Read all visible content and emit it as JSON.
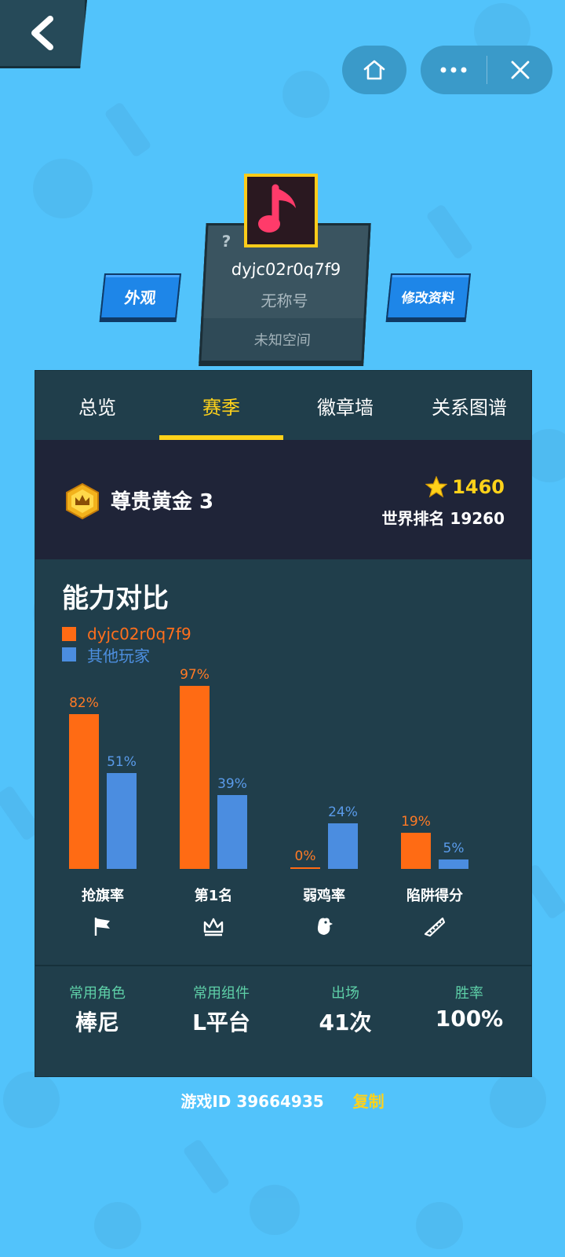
{
  "profile": {
    "username": "dyjc02r0q7f9",
    "title": "无称号",
    "space": "未知空间",
    "unknown_mark": "?",
    "appearance_button": "外观",
    "edit_button": "修改资料"
  },
  "tabs": [
    {
      "label": "总览"
    },
    {
      "label": "赛季"
    },
    {
      "label": "徽章墙"
    },
    {
      "label": "关系图谱"
    }
  ],
  "rank": {
    "name": "尊贵黄金 3",
    "stars": "1460",
    "world_rank": "世界排名 19260"
  },
  "ability": {
    "title": "能力对比",
    "legend_me": "dyjc02r0q7f9",
    "legend_other": "其他玩家"
  },
  "chart_data": {
    "type": "bar",
    "categories": [
      "抢旗率",
      "第1名",
      "弱鸡率",
      "陷阱得分"
    ],
    "series": [
      {
        "name": "dyjc02r0q7f9",
        "values": [
          82,
          97,
          0,
          19
        ],
        "color": "#ff6b14"
      },
      {
        "name": "其他玩家",
        "values": [
          51,
          39,
          24,
          5
        ],
        "color": "#4b8de0"
      }
    ],
    "value_labels_me": [
      "82%",
      "97%",
      "0%",
      "19%"
    ],
    "value_labels_other": [
      "51%",
      "39%",
      "24%",
      "5%"
    ],
    "category_icons": [
      "flag-icon",
      "crown-icon",
      "chicken-icon",
      "ruler-icon"
    ],
    "ylim": [
      0,
      100
    ]
  },
  "stats": [
    {
      "label": "常用角色",
      "value": "棒尼"
    },
    {
      "label": "常用组件",
      "value": "L平台"
    },
    {
      "label": "出场",
      "value": "41次"
    },
    {
      "label": "胜率",
      "value": "100%"
    }
  ],
  "footer": {
    "game_id": "游戏ID 39664935",
    "copy_label": "复制"
  },
  "colors": {
    "background": "#52c3fb",
    "panel": "#203e4b",
    "accent": "#ffd21a",
    "me": "#ff6b14",
    "other": "#4b8de0"
  }
}
